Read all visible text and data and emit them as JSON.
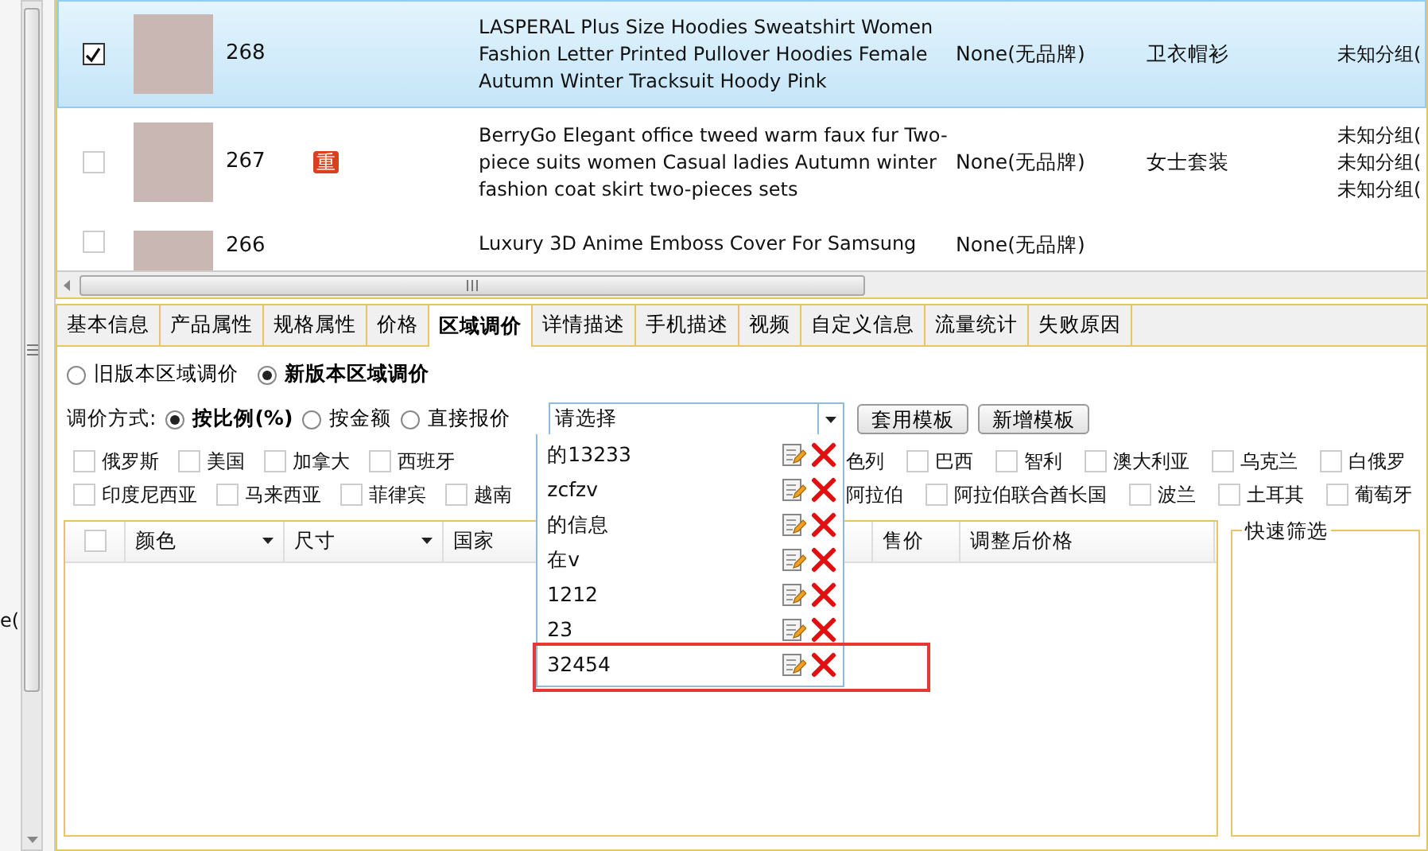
{
  "side_text": "e(",
  "products": [
    {
      "selected": true,
      "checked": true,
      "number": "268",
      "title": "LASPERAL Plus Size Hoodies Sweatshirt Women Fashion Letter Printed Pullover Hoodies Female Autumn Winter Tracksuit Hoody Pink",
      "brand": "None(无品牌)",
      "category": "卫衣帽衫",
      "groups": [
        "未知分组("
      ]
    },
    {
      "selected": false,
      "checked": false,
      "number": "267",
      "duplicate_tag": "重",
      "title": "BerryGo Elegant office tweed warm faux fur Two-piece suits women Casual ladies Autumn winter fashion coat skirt two-pieces sets",
      "brand": "None(无品牌)",
      "category": "女士套装",
      "groups": [
        "未知分组(",
        "未知分组(",
        "未知分组("
      ]
    },
    {
      "selected": false,
      "checked": false,
      "number": "266",
      "title": "Luxury 3D Anime Emboss Cover For Samsung",
      "brand": "None(无品牌)"
    }
  ],
  "tabs": [
    {
      "label": "基本信息",
      "selected": false
    },
    {
      "label": "产品属性",
      "selected": false
    },
    {
      "label": "规格属性",
      "selected": false
    },
    {
      "label": "价格",
      "selected": false
    },
    {
      "label": "区域调价",
      "selected": true
    },
    {
      "label": "详情描述",
      "selected": false
    },
    {
      "label": "手机描述",
      "selected": false
    },
    {
      "label": "视频",
      "selected": false
    },
    {
      "label": "自定义信息",
      "selected": false
    },
    {
      "label": "流量统计",
      "selected": false
    },
    {
      "label": "失败原因",
      "selected": false
    }
  ],
  "version_options": [
    {
      "label": "旧版本区域调价",
      "selected": false
    },
    {
      "label": "新版本区域调价",
      "selected": true
    }
  ],
  "pricing_method": {
    "label": "调价方式:",
    "options": [
      {
        "label": "按比例(%)",
        "selected": true
      },
      {
        "label": "按金额",
        "selected": false
      },
      {
        "label": "直接报价",
        "selected": false
      }
    ]
  },
  "template_select": {
    "value": "请选择",
    "expanded": true,
    "items": [
      {
        "label": "的13233",
        "highlighted": false
      },
      {
        "label": "zcfzv",
        "highlighted": false
      },
      {
        "label": "的信息",
        "highlighted": false
      },
      {
        "label": "在v",
        "highlighted": false
      },
      {
        "label": "1212",
        "highlighted": false
      },
      {
        "label": "23",
        "highlighted": false
      },
      {
        "label": "32454",
        "highlighted": true
      }
    ]
  },
  "buttons": [
    "套用模板",
    "新增模板"
  ],
  "country_rows": [
    {
      "before_dropdown": [
        {
          "kind": "checkbox",
          "label": "俄罗斯",
          "checked": false
        },
        {
          "kind": "checkbox",
          "label": "美国",
          "checked": false
        },
        {
          "kind": "checkbox",
          "label": "加拿大",
          "checked": false
        },
        {
          "kind": "checkbox",
          "label": "西班牙",
          "checked": false
        }
      ],
      "after_dropdown": [
        {
          "kind": "partial",
          "label": "色列"
        },
        {
          "kind": "checkbox",
          "label": "巴西",
          "checked": false
        },
        {
          "kind": "checkbox",
          "label": "智利",
          "checked": false
        },
        {
          "kind": "checkbox",
          "label": "澳大利亚",
          "checked": false
        },
        {
          "kind": "checkbox",
          "label": "乌克兰",
          "checked": false
        },
        {
          "kind": "checkbox",
          "label": "白俄罗",
          "checked": false
        }
      ]
    },
    {
      "before_dropdown": [
        {
          "kind": "checkbox",
          "label": "印度尼西亚",
          "checked": false
        },
        {
          "kind": "checkbox",
          "label": "马来西亚",
          "checked": false
        },
        {
          "kind": "checkbox",
          "label": "菲律宾",
          "checked": false
        },
        {
          "kind": "checkbox",
          "label": "越南",
          "checked": false
        }
      ],
      "after_dropdown": [
        {
          "kind": "partial",
          "label": "阿拉伯"
        },
        {
          "kind": "checkbox",
          "label": "阿拉伯联合酋长国",
          "checked": false
        },
        {
          "kind": "checkbox",
          "label": "波兰",
          "checked": false
        },
        {
          "kind": "checkbox",
          "label": "土耳其",
          "checked": false
        },
        {
          "kind": "checkbox",
          "label": "葡萄牙",
          "checked": false
        }
      ]
    }
  ],
  "price_grid": {
    "select_all_checked": false,
    "columns": [
      {
        "label": "颜色",
        "kind": "filter"
      },
      {
        "label": "尺寸",
        "kind": "filter"
      },
      {
        "label": "国家",
        "kind": "plain"
      },
      {
        "label": "售价",
        "kind": "plain"
      },
      {
        "label": "调整后价格",
        "kind": "plain"
      }
    ]
  },
  "quick_filter": {
    "title": "快速筛选"
  }
}
